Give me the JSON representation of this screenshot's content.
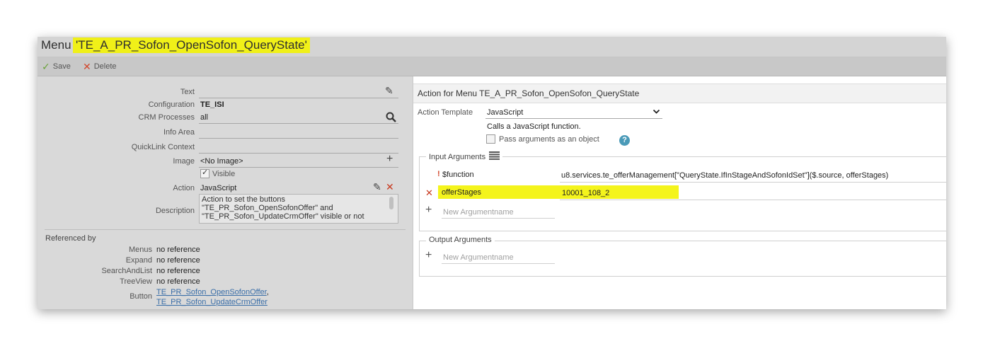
{
  "header": {
    "title_prefix": "Menu",
    "title_name": "'TE_A_PR_Sofon_OpenSofon_QueryState'"
  },
  "toolbar": {
    "save_label": "Save",
    "delete_label": "Delete"
  },
  "form": {
    "text_label": "Text",
    "text_value": "",
    "configuration_label": "Configuration",
    "configuration_value": "TE_ISI",
    "crm_processes_label": "CRM Processes",
    "crm_processes_value": "all",
    "info_area_label": "Info Area",
    "info_area_value": "",
    "quicklink_label": "QuickLink Context",
    "quicklink_value": "",
    "image_label": "Image",
    "image_value": "<No Image>",
    "visible_label": "Visible",
    "action_label": "Action",
    "action_value": "JavaScript",
    "description_label": "Description",
    "description_lines": [
      "Action to set the buttons",
      "\"TE_PR_Sofon_OpenSofonOffer\" and",
      "\"TE_PR_Sofon_UpdateCrmOffer\" visible or not"
    ]
  },
  "referenced_by": {
    "title": "Referenced by",
    "menus_label": "Menus",
    "menus_value": "no reference",
    "expand_label": "Expand",
    "expand_value": "no reference",
    "searchandlist_label": "SearchAndList",
    "searchandlist_value": "no reference",
    "treeview_label": "TreeView",
    "treeview_value": "no reference",
    "button_label": "Button",
    "button_links": [
      "TE_PR_Sofon_OpenSofonOffer",
      "TE_PR_Sofon_UpdateCrmOffer"
    ],
    "button_separator": ","
  },
  "action_panel": {
    "header": "Action for Menu TE_A_PR_Sofon_OpenSofon_QueryState",
    "template_label": "Action Template",
    "template_value": "JavaScript",
    "template_description": "Calls a JavaScript function.",
    "pass_args_label": "Pass arguments as an object",
    "help_glyph": "?",
    "input_args_title": "Input Arguments",
    "input_args": [
      {
        "marker": "!",
        "name": "$function",
        "value": "u8.services.te_offerManagement[\"QueryState.IfInStageAndSofonIdSet\"]($.source, offerStages)"
      },
      {
        "marker": "✕",
        "name": "offerStages",
        "value": "10001_108_2"
      }
    ],
    "new_argument_placeholder": "New Argumentname",
    "output_args_title": "Output Arguments",
    "new_output_placeholder": "New Argumentname"
  },
  "colors": {
    "highlight": "#f0f018",
    "save_green": "#6aa23a",
    "delete_red": "#d2472c",
    "help_blue": "#4a9ab8",
    "link_blue": "#3a6ea8"
  },
  "icons": {
    "save": "check-icon",
    "delete": "x-icon",
    "edit": "pencil-icon",
    "search": "magnifier-icon",
    "add": "plus-icon",
    "list": "list-icon",
    "help": "help-icon"
  }
}
